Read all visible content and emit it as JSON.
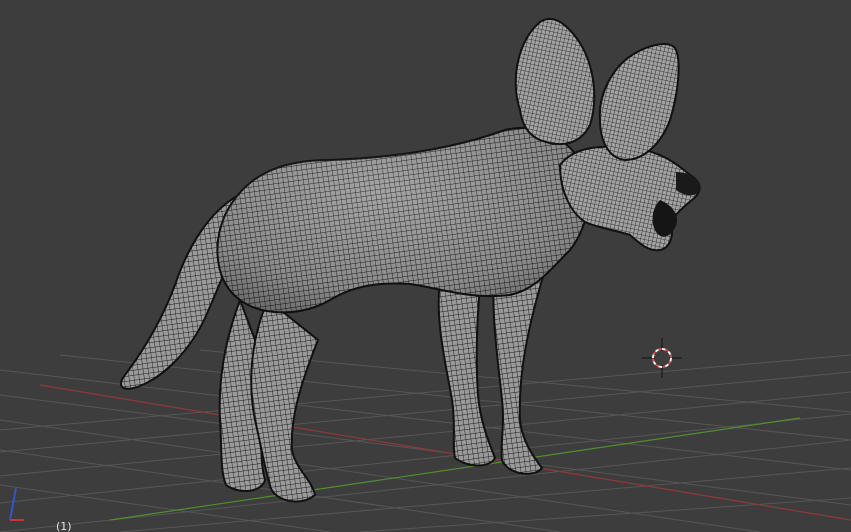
{
  "app": {
    "editor": "3D Viewport",
    "shading": "wireframe-over-solid",
    "object_subject": "fox"
  },
  "viewport": {
    "background_color": "#3d3d3d",
    "grid_color": "#565656",
    "x_axis_color": "#8f3a3a",
    "y_axis_color": "#4f8f2c",
    "mesh_fill_color": "#8f8f8f",
    "wire_color": "#1b1b1b",
    "frame_counter": "(1)"
  },
  "gizmo": {
    "axis_x_color": "#cc3333",
    "axis_z_color": "#3355cc"
  },
  "cursor": {
    "icon": "3d-cursor-icon",
    "ring_colors": [
      "#d94a4a",
      "#f0f0f0"
    ]
  }
}
